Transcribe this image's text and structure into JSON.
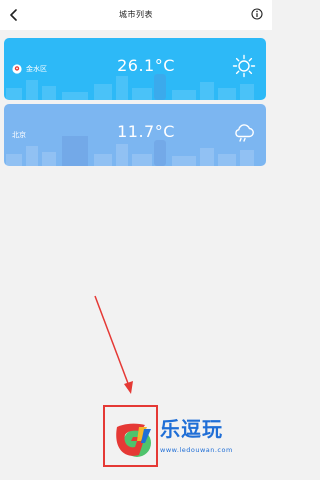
{
  "header": {
    "title": "城市列表",
    "back_icon": "back-arrow-icon",
    "info_icon": "info-icon"
  },
  "cities": [
    {
      "name": "金水区",
      "temperature": "26.1°C",
      "weather_icon": "sun-icon",
      "has_location_pin": true,
      "color": "#2db9f7"
    },
    {
      "name": "北京",
      "temperature": "11.7°C",
      "weather_icon": "cloud-rain-icon",
      "has_location_pin": false,
      "color": "#7cb6f1"
    }
  ],
  "watermark": {
    "brand": "乐逗玩",
    "url": "www.ledouwan.com",
    "highlight_color": "#e53935"
  }
}
